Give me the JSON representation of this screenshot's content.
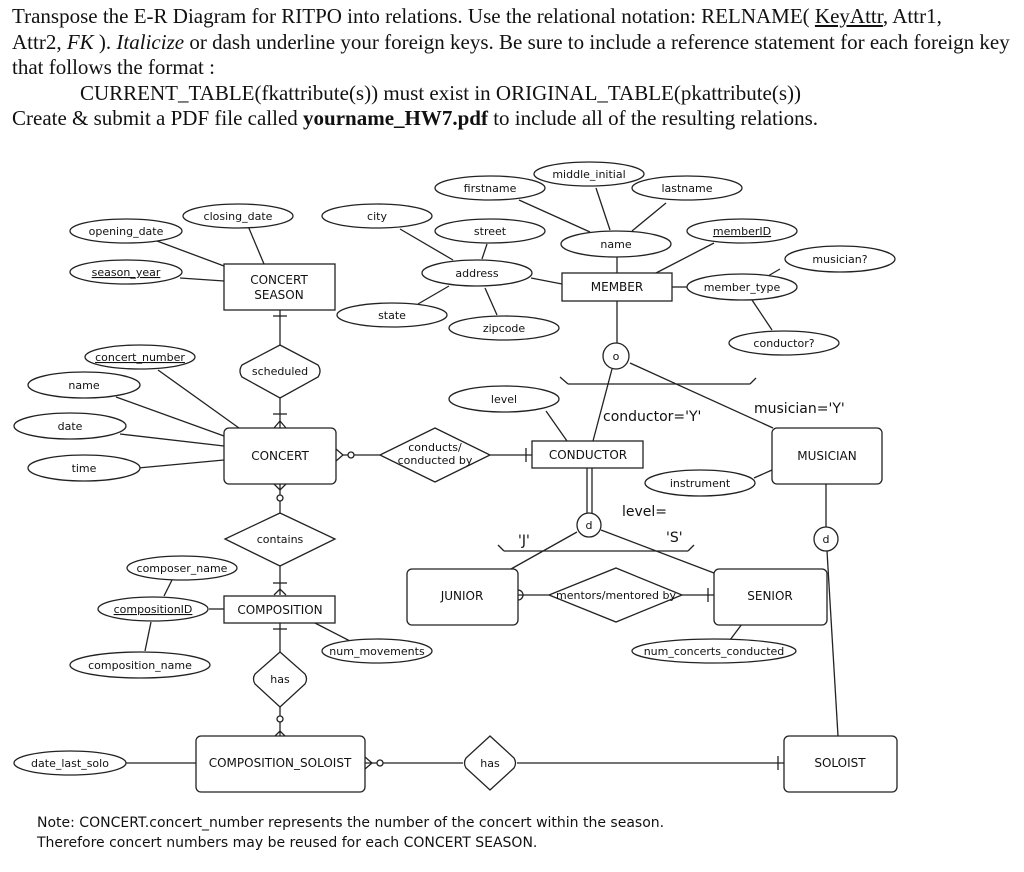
{
  "instructions": {
    "line1_a": "Transpose the E-R Diagram for RITPO into relations. Use the relational notation:  RELNAME( ",
    "line1_key": "KeyAttr",
    "line1_b": ", Attr1,",
    "line2_a": "Attr2, ",
    "line2_fk": "FK",
    "line2_b": " ).  ",
    "line2_italic": "Italicize",
    "line2_c": "  or dash underline your foreign keys. Be sure to include a reference statement for each foreign key",
    "line3": "that follows the format :",
    "line4": "CURRENT_TABLE(fkattribute(s)) must exist in ORIGINAL_TABLE(pkattribute(s))",
    "line5_a": "Create & submit a PDF file called ",
    "line5_bold": "yourname_HW7.pdf",
    "line5_b": " to include all of the resulting relations."
  },
  "entities": {
    "concert_season_1": "CONCERT",
    "concert_season_2": "SEASON",
    "member": "MEMBER",
    "concert": "CONCERT",
    "conductor": "CONDUCTOR",
    "musician": "MUSICIAN",
    "composition": "COMPOSITION",
    "junior": "JUNIOR",
    "senior": "SENIOR",
    "composition_soloist": "COMPOSITION_SOLOIST",
    "soloist": "SOLOIST"
  },
  "relationships": {
    "scheduled": "scheduled",
    "conducts_1": "conducts/",
    "conducts_2": "conducted by",
    "contains": "contains",
    "mentors": "mentors/mentored by",
    "has_composition": "has",
    "has_soloist": "has"
  },
  "attributes": {
    "opening_date": "opening_date",
    "closing_date": "closing_date",
    "season_year": "season_year",
    "city": "city",
    "street": "street",
    "address": "address",
    "state": "state",
    "zipcode": "zipcode",
    "firstname": "firstname",
    "middle_initial": "middle_initial",
    "lastname": "lastname",
    "name_member": "name",
    "memberID": "memberID",
    "musician_q": "musician?",
    "member_type": "member_type",
    "conductor_q": "conductor?",
    "concert_number": "concert_number",
    "name_concert": "name",
    "date": "date",
    "time": "time",
    "level": "level",
    "instrument": "instrument",
    "composer_name": "composer_name",
    "compositionID": "compositionID",
    "composition_name": "composition_name",
    "num_movements": "num_movements",
    "num_concerts_conducted": "num_concerts_conducted",
    "date_last_solo": "date_last_solo"
  },
  "specialization": {
    "member_circle": "o",
    "conductor_circle": "d",
    "musician_circle": "d",
    "conductor_label": "conductor='Y'",
    "musician_label": "musician='Y'",
    "level_label": "level=",
    "junior_label": "'J'",
    "senior_label": "'S'"
  },
  "note": {
    "line1": "Note: CONCERT.concert_number represents the number of the concert within the season.",
    "line2": "Therefore concert  numbers may be reused for each CONCERT SEASON."
  }
}
